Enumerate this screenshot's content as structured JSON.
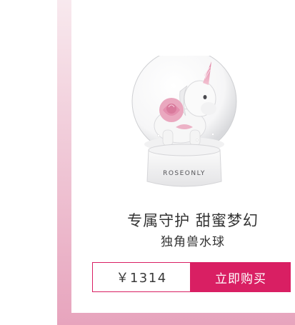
{
  "product": {
    "title": "专属守护 甜蜜梦幻",
    "subtitle": "独角兽水球",
    "brand_print": "ROSEONLY",
    "image_icon": "unicorn-snow-globe"
  },
  "purchase": {
    "price": "￥1314",
    "buy_label": "立即购买"
  },
  "colors": {
    "accent": "#d91f63",
    "frame_top": "#f8e9ee",
    "frame_bottom": "#e7a4bd",
    "text": "#333333"
  }
}
